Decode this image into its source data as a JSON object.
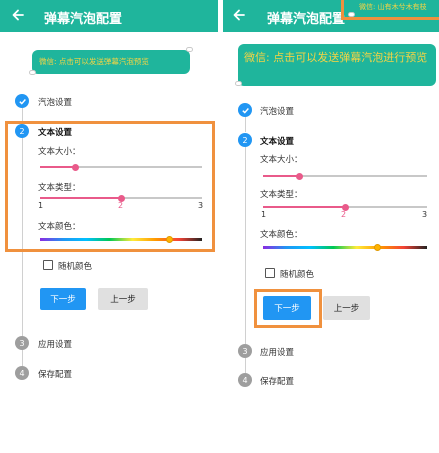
{
  "left": {
    "title": "弹幕汽泡配置",
    "bubble_text": "微信: 点击可以发送弹幕汽泡预览",
    "steps": [
      {
        "num": "",
        "label": "汽泡设置"
      },
      {
        "num": "2",
        "label": "文本设置"
      },
      {
        "num": "3",
        "label": "应用设置"
      },
      {
        "num": "4",
        "label": "保存配置"
      }
    ],
    "text_size_label": "文本大小：",
    "text_size_level": 0.22,
    "text_type_label": "文本类型：",
    "text_type_ticks": [
      "1",
      "2",
      "3"
    ],
    "text_type_value": 2,
    "text_color_label": "文本颜色：",
    "text_color_level": 0.8,
    "random_color_label": "随机颜色",
    "next_label": "下一步",
    "prev_label": "上一步"
  },
  "right": {
    "title": "弹幕汽泡配置",
    "bubble_text": "微信: 点击可以发送弹幕汽泡进行预览",
    "top_bubble_text": "微信: 山有木兮木有枝",
    "steps": [
      {
        "num": "",
        "label": "汽泡设置"
      },
      {
        "num": "2",
        "label": "文本设置"
      },
      {
        "num": "3",
        "label": "应用设置"
      },
      {
        "num": "4",
        "label": "保存配置"
      }
    ],
    "text_size_label": "文本大小：",
    "text_size_level": 0.22,
    "text_type_label": "文本类型：",
    "text_type_ticks": [
      "1",
      "2",
      "3"
    ],
    "text_type_value": 2,
    "text_color_label": "文本颜色：",
    "text_color_level": 0.7,
    "random_color_label": "随机颜色",
    "next_label": "下一步",
    "prev_label": "上一步"
  },
  "colors": {
    "appbar": "#1fb59c",
    "bubble_text": "#f4d444",
    "accent": "#2196f3",
    "slider": "#e95a8a",
    "highlight": "#f0913e"
  },
  "icons": {
    "back": "arrow-left-icon",
    "done": "check-icon"
  }
}
